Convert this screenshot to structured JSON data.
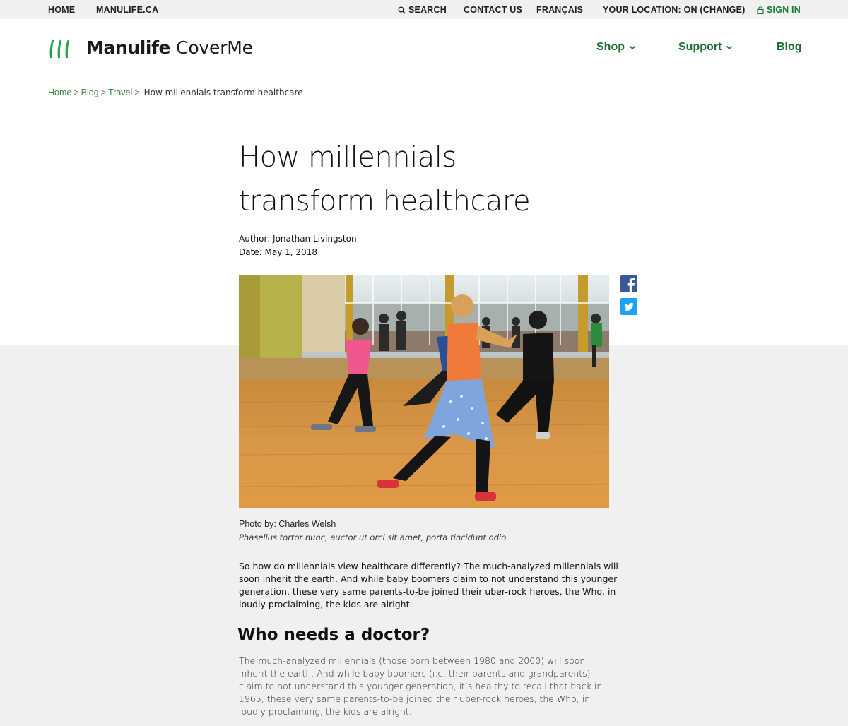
{
  "utility_nav": {
    "home": "HOME",
    "manulife": "MANULIFE.CA",
    "search": "SEARCH",
    "contact": "CONTACT US",
    "language": "FRANÇAIS",
    "location": "YOUR LOCATION: ON (CHANGE)",
    "sign_in": "SIGN IN"
  },
  "brand": {
    "name": "Manulife",
    "product": "CoverMe",
    "accent_color": "#1d7b3a"
  },
  "main_nav": {
    "shop": "Shop",
    "support": "Support",
    "blog": "Blog"
  },
  "breadcrumb": {
    "home": "Home",
    "blog": "Blog",
    "travel": "Travel",
    "separator": ">",
    "current": "How millennials transform healthcare"
  },
  "article": {
    "title_line1": "How millennials",
    "title_line2": "transform healthcare",
    "author": "Author: Jonathan Livingston",
    "date": "Date: May 1, 2018",
    "photo_credit": "Photo by: Charles Welsh",
    "photo_caption": "Phasellus tortor nunc, auctor ut orci sit amet, porta tincidunt odio.",
    "intro": "So how do millennials view healthcare differently? The much-analyzed millennials will soon inherit the earth. And while baby boomers claim to not understand this younger generation, these very same parents-to-be joined their uber-rock heroes, the Who, in loudly proclaiming, the kids are alright.",
    "section_heading": "Who needs a doctor?",
    "section_body": "The much-analyzed millennials (those born between 1980 and 2000) will soon inherit the earth. And while baby boomers (i.e. their parents and grandparents) claim to not understand this younger generation, it’s healthy to recall that back in 1965, these very same parents-to-be joined their uber-rock heroes, the Who, in loudly proclaiming, the kids are alright."
  },
  "icons": {
    "search": "search-icon",
    "lock": "lock-icon",
    "chevron": "chevron-down-icon",
    "facebook": "facebook-icon",
    "twitter": "twitter-icon"
  }
}
